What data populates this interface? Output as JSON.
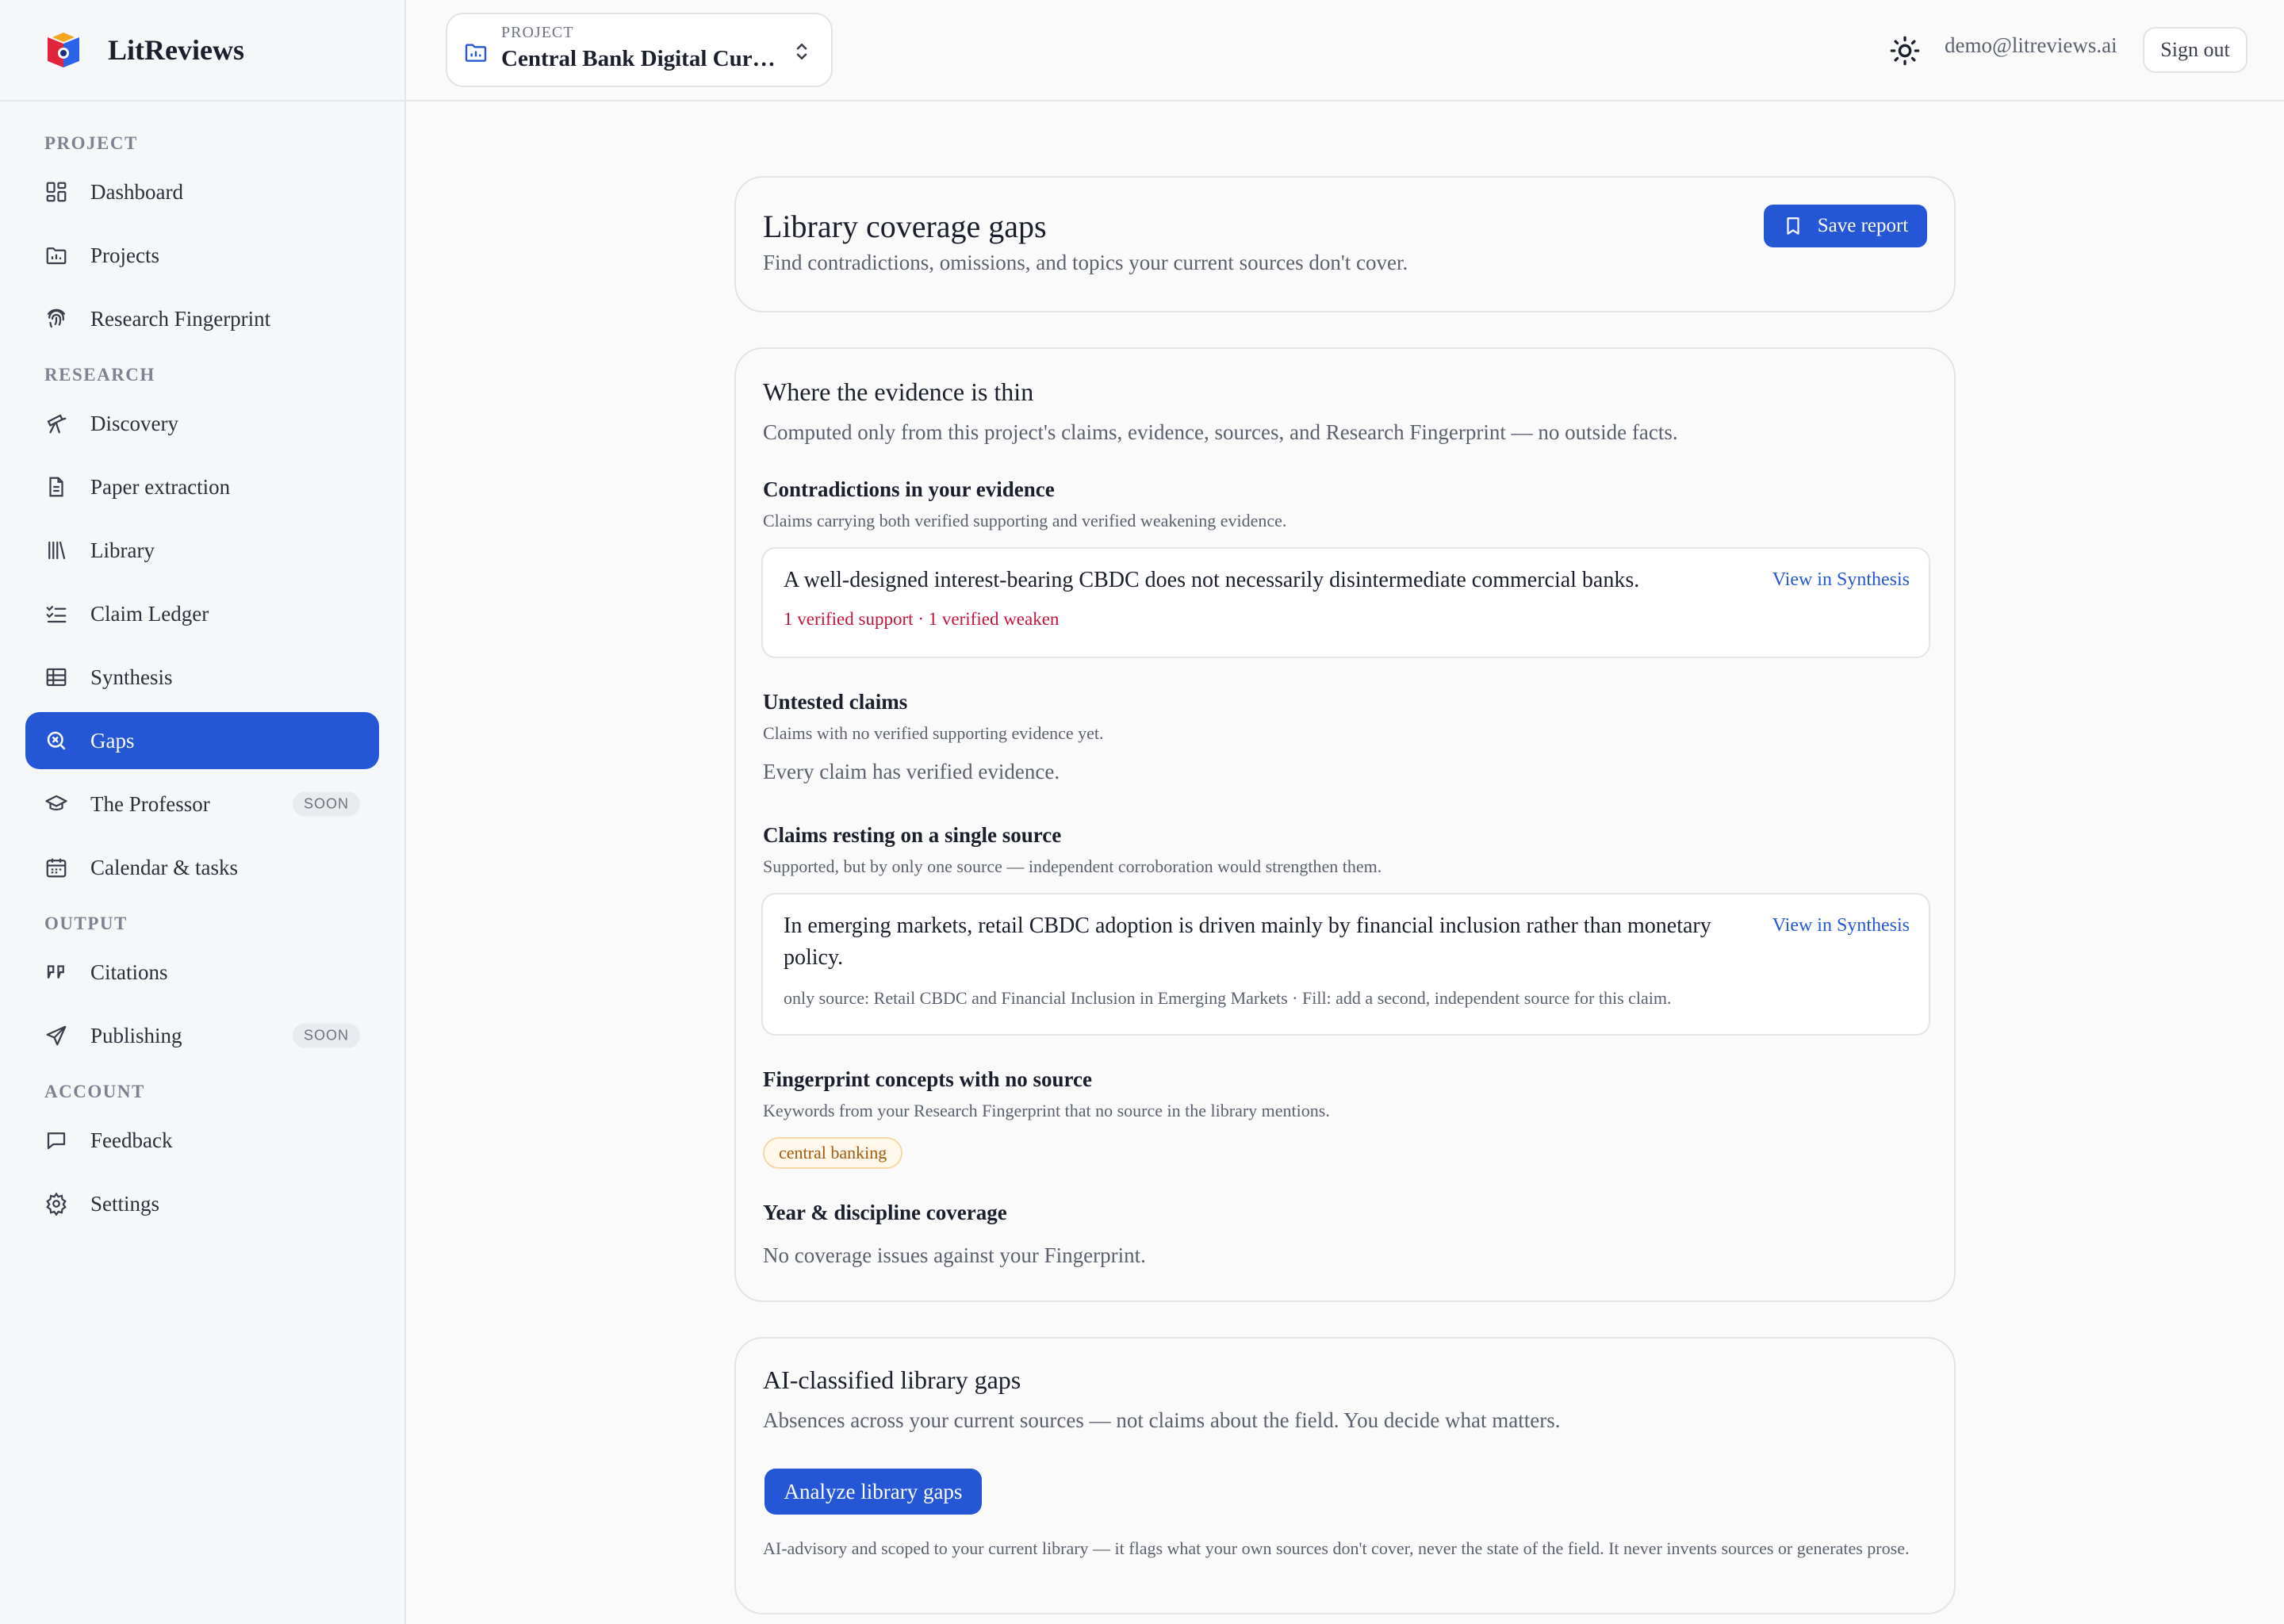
{
  "brand": {
    "name": "LitReviews"
  },
  "sidebar": {
    "sections": [
      {
        "label": "PROJECT"
      },
      {
        "label": "RESEARCH"
      },
      {
        "label": "OUTPUT"
      },
      {
        "label": "ACCOUNT"
      }
    ],
    "items": [
      {
        "label": "Dashboard"
      },
      {
        "label": "Projects"
      },
      {
        "label": "Research Fingerprint"
      },
      {
        "label": "Discovery"
      },
      {
        "label": "Paper extraction"
      },
      {
        "label": "Library"
      },
      {
        "label": "Claim Ledger"
      },
      {
        "label": "Synthesis"
      },
      {
        "label": "Gaps"
      },
      {
        "label": "The Professor",
        "badge": "SOON"
      },
      {
        "label": "Calendar & tasks"
      },
      {
        "label": "Citations"
      },
      {
        "label": "Publishing",
        "badge": "SOON"
      },
      {
        "label": "Feedback"
      },
      {
        "label": "Settings"
      }
    ],
    "active_item": "Gaps",
    "active_color": "#2456d6"
  },
  "topbar": {
    "project_label": "PROJECT",
    "project_name": "Central Bank Digital Currencies",
    "user_email": "demo@litreviews.ai",
    "sign_out": "Sign out"
  },
  "header": {
    "title": "Library coverage gaps",
    "subtitle": "Find contradictions, omissions, and topics your current sources don't cover.",
    "save_label": "Save report"
  },
  "evidence": {
    "title": "Where the evidence is thin",
    "subtitle": "Computed only from this project's claims, evidence, sources, and Research Fingerprint — no outside facts.",
    "contradictions": {
      "title": "Contradictions in your evidence",
      "desc": "Claims carrying both verified supporting and verified weakening evidence.",
      "claim": "A well-designed interest-bearing CBDC does not necessarily disintermediate commercial banks.",
      "link": "View in Synthesis",
      "meta": "1 verified support · 1 verified weaken"
    },
    "untested": {
      "title": "Untested claims",
      "desc": "Claims with no verified supporting evidence yet.",
      "empty": "Every claim has verified evidence."
    },
    "single_source": {
      "title": "Claims resting on a single source",
      "desc": "Supported, but by only one source — independent corroboration would strengthen them.",
      "claim": "In emerging markets, retail CBDC adoption is driven mainly by financial inclusion rather than monetary policy.",
      "link": "View in Synthesis",
      "meta": "only source: Retail CBDC and Financial Inclusion in Emerging Markets · Fill: add a second, independent source for this claim."
    },
    "fingerprint": {
      "title": "Fingerprint concepts with no source",
      "desc": "Keywords from your Research Fingerprint that no source in the library mentions.",
      "tag": "central banking"
    },
    "coverage": {
      "title": "Year & discipline coverage",
      "empty": "No coverage issues against your Fingerprint."
    }
  },
  "ai": {
    "title": "AI-classified library gaps",
    "subtitle": "Absences across your current sources — not claims about the field. You decide what matters.",
    "button": "Analyze library gaps",
    "disclaimer": "AI-advisory and scoped to your current library — it flags what your own sources don't cover, never the state of the field. It never invents sources or generates prose."
  }
}
